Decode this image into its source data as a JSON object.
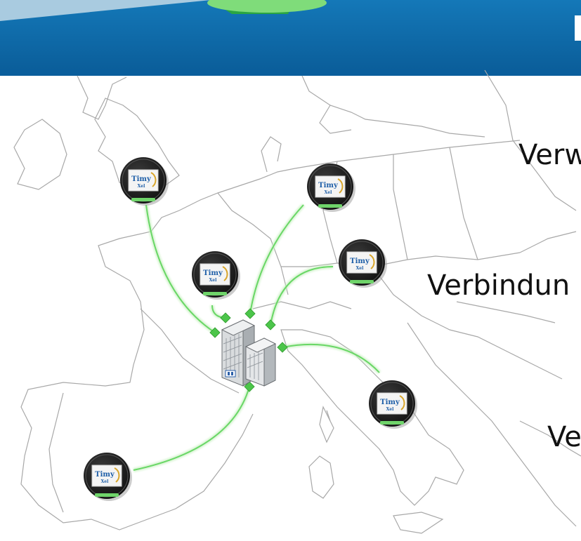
{
  "slide": {
    "header_color": "#0e6aab",
    "accent_green": "#6fd46a",
    "map_stroke_color": "#a8a8a8"
  },
  "labels": [
    "Verw",
    "Verbindun",
    "Ve"
  ],
  "badge": {
    "line1": "Timy",
    "line2": "Xel",
    "icon": "timyxel-logo"
  },
  "nodes": [
    {
      "id": "site-london"
    },
    {
      "id": "site-germany"
    },
    {
      "id": "site-paris"
    },
    {
      "id": "site-austria"
    },
    {
      "id": "site-italy"
    },
    {
      "id": "site-spain"
    }
  ],
  "hub": {
    "icon": "office-building-icon"
  }
}
